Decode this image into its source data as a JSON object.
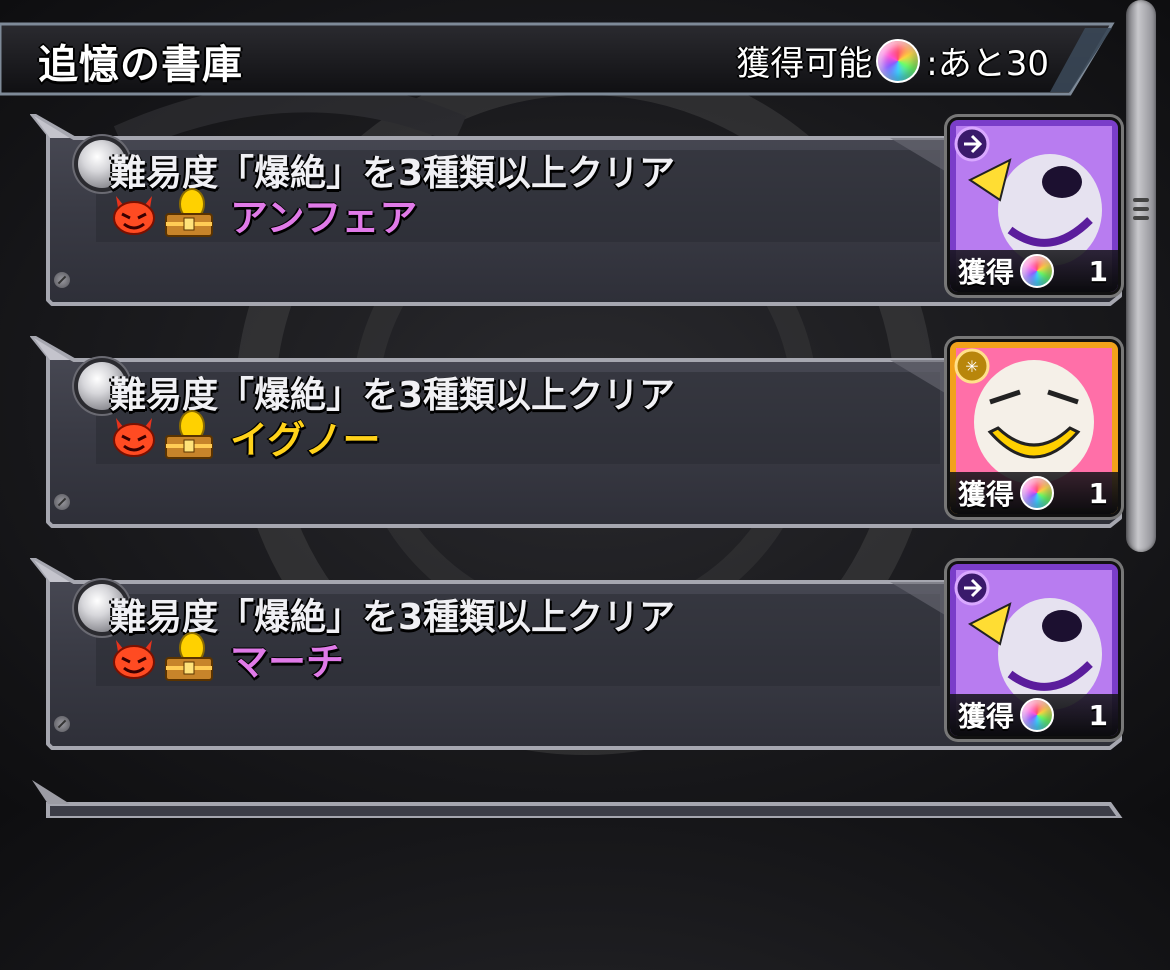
{
  "header": {
    "title": "追憶の書庫",
    "obtainable_label": "獲得可能",
    "remaining_label": ":あと30"
  },
  "missions": [
    {
      "text": "難易度「爆絶」を3種類以上クリア",
      "boss_name": "アンフェア",
      "boss_name_color": "#e07ae8",
      "gain_label": "獲得",
      "gain_count": "1",
      "portrait_theme": "purple",
      "element_icon": "dark-element-icon"
    },
    {
      "text": "難易度「爆絶」を3種類以上クリア",
      "boss_name": "イグノー",
      "boss_name_color": "#ffd21a",
      "gain_label": "獲得",
      "gain_count": "1",
      "portrait_theme": "gold",
      "element_icon": "light-element-icon"
    },
    {
      "text": "難易度「爆絶」を3種類以上クリア",
      "boss_name": "マーチ",
      "boss_name_color": "#e07ae8",
      "gain_label": "獲得",
      "gain_count": "1",
      "portrait_theme": "purple",
      "element_icon": "dark-element-icon"
    }
  ],
  "colors": {
    "card_body": "#3c3d47",
    "card_border": "#a6a7b0",
    "accent_purple": "#e07ae8",
    "accent_gold": "#ffd21a"
  }
}
